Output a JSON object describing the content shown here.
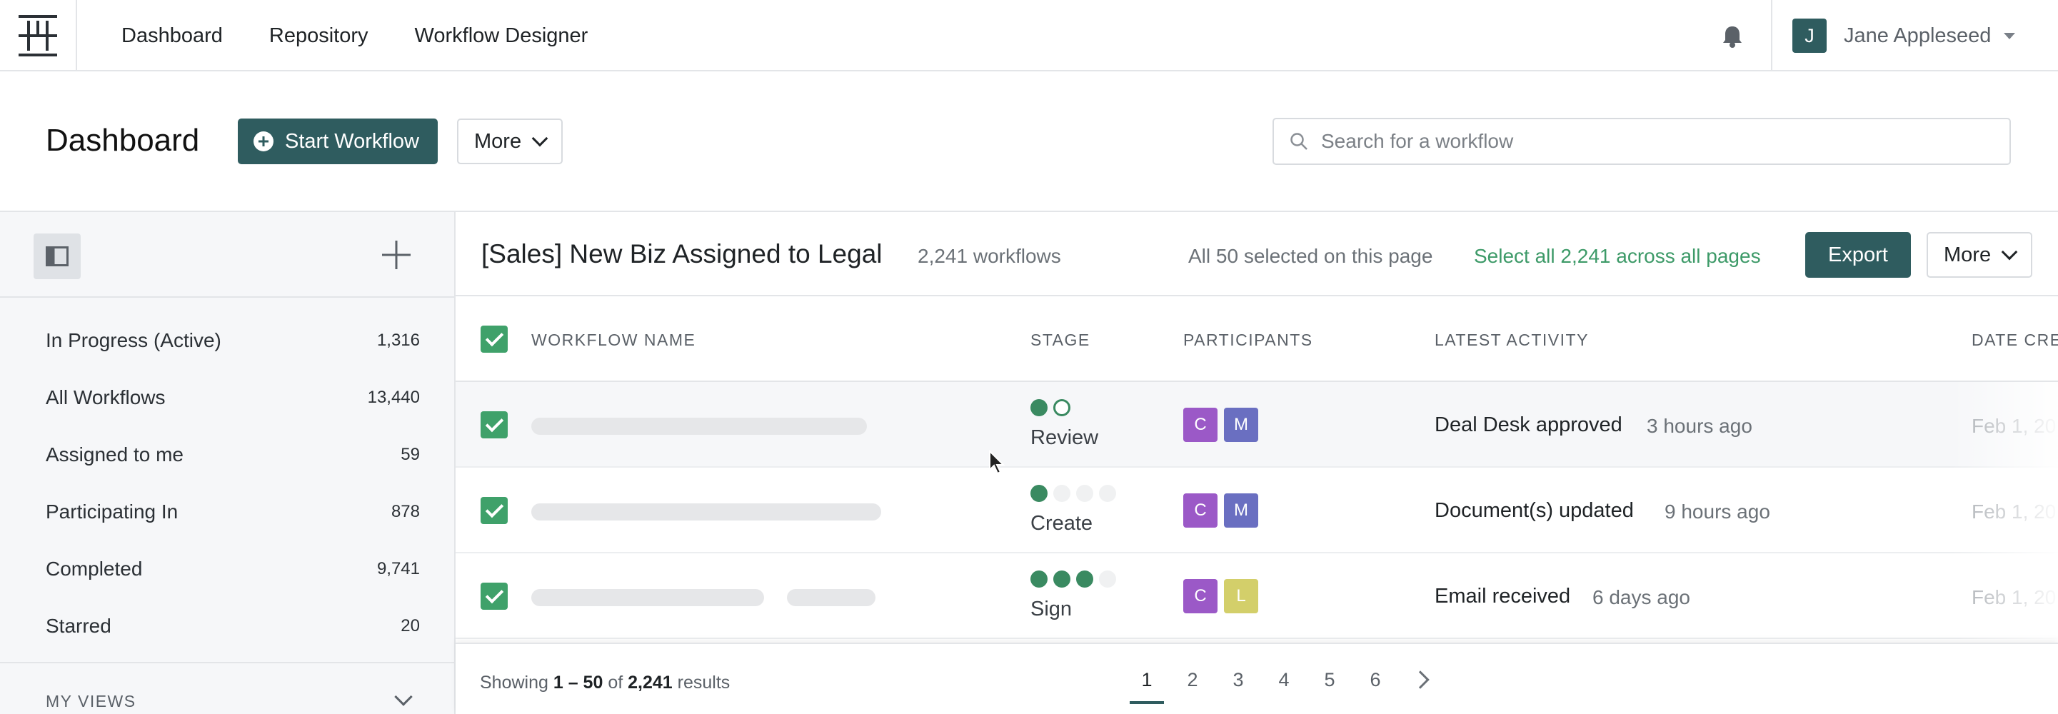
{
  "nav": {
    "links": [
      "Dashboard",
      "Repository",
      "Workflow Designer"
    ],
    "user_initial": "J",
    "user_name": "Jane Appleseed"
  },
  "header": {
    "title": "Dashboard",
    "start_label": "Start Workflow",
    "more_label": "More",
    "search_placeholder": "Search for a workflow"
  },
  "sidebar": {
    "items": [
      {
        "label": "In Progress (Active)",
        "count": "1,316"
      },
      {
        "label": "All Workflows",
        "count": "13,440"
      },
      {
        "label": "Assigned to me",
        "count": "59"
      },
      {
        "label": "Participating In",
        "count": "878"
      },
      {
        "label": "Completed",
        "count": "9,741"
      },
      {
        "label": "Starred",
        "count": "20"
      }
    ],
    "my_views_label": "MY VIEWS"
  },
  "view": {
    "title": "[Sales] New Biz Assigned to Legal",
    "count": "2,241 workflows",
    "selected_text": "All 50 selected on this page",
    "select_all_label": "Select all 2,241 across all pages",
    "export_label": "Export",
    "more_label": "More"
  },
  "table": {
    "headers": [
      "WORKFLOW NAME",
      "STAGE",
      "PARTICIPANTS",
      "LATEST ACTIVITY",
      "DATE CRE"
    ],
    "rows": [
      {
        "stage": "Review",
        "participants": [
          "C",
          "M"
        ],
        "activity": "Deal Desk approved",
        "ago": "3 hours ago",
        "date": "Feb 1, 20"
      },
      {
        "stage": "Create",
        "participants": [
          "C",
          "M"
        ],
        "activity": "Document(s) updated",
        "ago": "9 hours ago",
        "date": "Feb 1, 20"
      },
      {
        "stage": "Sign",
        "participants": [
          "C",
          "L"
        ],
        "activity": "Email received",
        "ago": "6 days ago",
        "date": "Feb 1, 20"
      }
    ]
  },
  "colors": {
    "accent": "#2f5c5f",
    "green": "#3fa16a",
    "avatar_c": "#9b59c7",
    "avatar_m": "#6a6fc1",
    "avatar_l": "#d3cf6a"
  },
  "footer": {
    "showing_prefix": "Showing",
    "range": "1 – 50",
    "of": "of",
    "total": "2,241",
    "suffix": "results",
    "pages": [
      "1",
      "2",
      "3",
      "4",
      "5",
      "6"
    ]
  }
}
